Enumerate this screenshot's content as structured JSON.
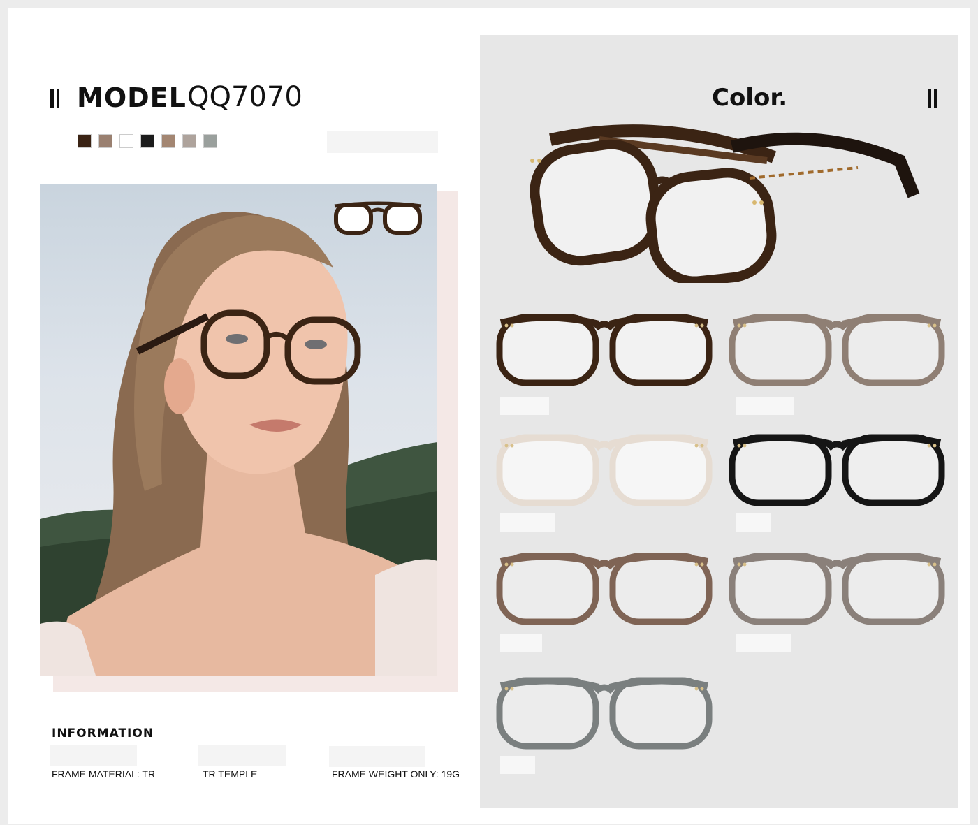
{
  "header": {
    "model_label": "MODEL",
    "model_code": "QQ7070"
  },
  "swatches": [
    {
      "name": "tortoise",
      "color": "#3a2314"
    },
    {
      "name": "brown",
      "color": "#9a8070"
    },
    {
      "name": "clear",
      "color": "#ffffff"
    },
    {
      "name": "black",
      "color": "#1c1c1c"
    },
    {
      "name": "tan",
      "color": "#a38672"
    },
    {
      "name": "grey-brown",
      "color": "#aea39c"
    },
    {
      "name": "grey",
      "color": "#9aa09d"
    }
  ],
  "color_panel": {
    "title": "Color."
  },
  "variants": [
    {
      "name": "tortoise",
      "frame": "#3b2414",
      "accent": "#a06a2c",
      "lens": "#f2f2f2"
    },
    {
      "name": "translucent-brown-grey",
      "frame": "#8f7f74",
      "accent": "#b8aaa0",
      "lens": "#ececec"
    },
    {
      "name": "clear",
      "frame": "#e6dcd2",
      "accent": "#f4efe9",
      "lens": "#f6f6f6"
    },
    {
      "name": "black",
      "frame": "#151515",
      "accent": "#3c3c3c",
      "lens": "#eeeeee"
    },
    {
      "name": "translucent-brown",
      "frame": "#7f6455",
      "accent": "#a88c7c",
      "lens": "#ececec"
    },
    {
      "name": "translucent-grey-brown",
      "frame": "#8a807a",
      "accent": "#aaa29c",
      "lens": "#ececec"
    },
    {
      "name": "translucent-grey",
      "frame": "#7a7f7f",
      "accent": "#a5aaaa",
      "lens": "#ececec"
    }
  ],
  "information": {
    "title": "INFORMATION",
    "specs": [
      "FRAME MATERIAL: TR",
      "TR  TEMPLE",
      "FRAME WEIGHT ONLY: 19G"
    ]
  }
}
